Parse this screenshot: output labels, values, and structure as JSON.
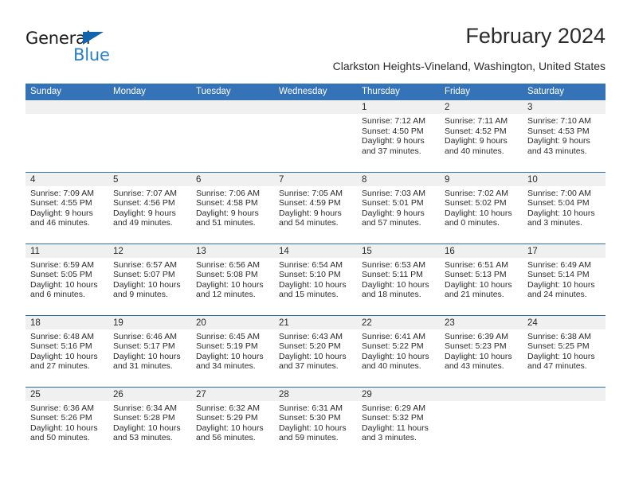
{
  "logo": {
    "word1": "General",
    "word2": "Blue",
    "triangle_color": "#1263ad",
    "blue_color": "#2a7fc9"
  },
  "header": {
    "title": "February 2024",
    "subtitle": "Clarkston Heights-Vineland, Washington, United States"
  },
  "theme": {
    "header_blue": "#3573b9",
    "separator_blue": "#2f6da8",
    "daynum_band": "#f0f0f0"
  },
  "calendar": {
    "weekdays": [
      "Sunday",
      "Monday",
      "Tuesday",
      "Wednesday",
      "Thursday",
      "Friday",
      "Saturday"
    ],
    "weeks": [
      [
        {
          "day": "",
          "lines": []
        },
        {
          "day": "",
          "lines": []
        },
        {
          "day": "",
          "lines": []
        },
        {
          "day": "",
          "lines": []
        },
        {
          "day": "1",
          "lines": [
            "Sunrise: 7:12 AM",
            "Sunset: 4:50 PM",
            "Daylight: 9 hours",
            "and 37 minutes."
          ]
        },
        {
          "day": "2",
          "lines": [
            "Sunrise: 7:11 AM",
            "Sunset: 4:52 PM",
            "Daylight: 9 hours",
            "and 40 minutes."
          ]
        },
        {
          "day": "3",
          "lines": [
            "Sunrise: 7:10 AM",
            "Sunset: 4:53 PM",
            "Daylight: 9 hours",
            "and 43 minutes."
          ]
        }
      ],
      [
        {
          "day": "4",
          "lines": [
            "Sunrise: 7:09 AM",
            "Sunset: 4:55 PM",
            "Daylight: 9 hours",
            "and 46 minutes."
          ]
        },
        {
          "day": "5",
          "lines": [
            "Sunrise: 7:07 AM",
            "Sunset: 4:56 PM",
            "Daylight: 9 hours",
            "and 49 minutes."
          ]
        },
        {
          "day": "6",
          "lines": [
            "Sunrise: 7:06 AM",
            "Sunset: 4:58 PM",
            "Daylight: 9 hours",
            "and 51 minutes."
          ]
        },
        {
          "day": "7",
          "lines": [
            "Sunrise: 7:05 AM",
            "Sunset: 4:59 PM",
            "Daylight: 9 hours",
            "and 54 minutes."
          ]
        },
        {
          "day": "8",
          "lines": [
            "Sunrise: 7:03 AM",
            "Sunset: 5:01 PM",
            "Daylight: 9 hours",
            "and 57 minutes."
          ]
        },
        {
          "day": "9",
          "lines": [
            "Sunrise: 7:02 AM",
            "Sunset: 5:02 PM",
            "Daylight: 10 hours",
            "and 0 minutes."
          ]
        },
        {
          "day": "10",
          "lines": [
            "Sunrise: 7:00 AM",
            "Sunset: 5:04 PM",
            "Daylight: 10 hours",
            "and 3 minutes."
          ]
        }
      ],
      [
        {
          "day": "11",
          "lines": [
            "Sunrise: 6:59 AM",
            "Sunset: 5:05 PM",
            "Daylight: 10 hours",
            "and 6 minutes."
          ]
        },
        {
          "day": "12",
          "lines": [
            "Sunrise: 6:57 AM",
            "Sunset: 5:07 PM",
            "Daylight: 10 hours",
            "and 9 minutes."
          ]
        },
        {
          "day": "13",
          "lines": [
            "Sunrise: 6:56 AM",
            "Sunset: 5:08 PM",
            "Daylight: 10 hours",
            "and 12 minutes."
          ]
        },
        {
          "day": "14",
          "lines": [
            "Sunrise: 6:54 AM",
            "Sunset: 5:10 PM",
            "Daylight: 10 hours",
            "and 15 minutes."
          ]
        },
        {
          "day": "15",
          "lines": [
            "Sunrise: 6:53 AM",
            "Sunset: 5:11 PM",
            "Daylight: 10 hours",
            "and 18 minutes."
          ]
        },
        {
          "day": "16",
          "lines": [
            "Sunrise: 6:51 AM",
            "Sunset: 5:13 PM",
            "Daylight: 10 hours",
            "and 21 minutes."
          ]
        },
        {
          "day": "17",
          "lines": [
            "Sunrise: 6:49 AM",
            "Sunset: 5:14 PM",
            "Daylight: 10 hours",
            "and 24 minutes."
          ]
        }
      ],
      [
        {
          "day": "18",
          "lines": [
            "Sunrise: 6:48 AM",
            "Sunset: 5:16 PM",
            "Daylight: 10 hours",
            "and 27 minutes."
          ]
        },
        {
          "day": "19",
          "lines": [
            "Sunrise: 6:46 AM",
            "Sunset: 5:17 PM",
            "Daylight: 10 hours",
            "and 31 minutes."
          ]
        },
        {
          "day": "20",
          "lines": [
            "Sunrise: 6:45 AM",
            "Sunset: 5:19 PM",
            "Daylight: 10 hours",
            "and 34 minutes."
          ]
        },
        {
          "day": "21",
          "lines": [
            "Sunrise: 6:43 AM",
            "Sunset: 5:20 PM",
            "Daylight: 10 hours",
            "and 37 minutes."
          ]
        },
        {
          "day": "22",
          "lines": [
            "Sunrise: 6:41 AM",
            "Sunset: 5:22 PM",
            "Daylight: 10 hours",
            "and 40 minutes."
          ]
        },
        {
          "day": "23",
          "lines": [
            "Sunrise: 6:39 AM",
            "Sunset: 5:23 PM",
            "Daylight: 10 hours",
            "and 43 minutes."
          ]
        },
        {
          "day": "24",
          "lines": [
            "Sunrise: 6:38 AM",
            "Sunset: 5:25 PM",
            "Daylight: 10 hours",
            "and 47 minutes."
          ]
        }
      ],
      [
        {
          "day": "25",
          "lines": [
            "Sunrise: 6:36 AM",
            "Sunset: 5:26 PM",
            "Daylight: 10 hours",
            "and 50 minutes."
          ]
        },
        {
          "day": "26",
          "lines": [
            "Sunrise: 6:34 AM",
            "Sunset: 5:28 PM",
            "Daylight: 10 hours",
            "and 53 minutes."
          ]
        },
        {
          "day": "27",
          "lines": [
            "Sunrise: 6:32 AM",
            "Sunset: 5:29 PM",
            "Daylight: 10 hours",
            "and 56 minutes."
          ]
        },
        {
          "day": "28",
          "lines": [
            "Sunrise: 6:31 AM",
            "Sunset: 5:30 PM",
            "Daylight: 10 hours",
            "and 59 minutes."
          ]
        },
        {
          "day": "29",
          "lines": [
            "Sunrise: 6:29 AM",
            "Sunset: 5:32 PM",
            "Daylight: 11 hours",
            "and 3 minutes."
          ]
        },
        {
          "day": "",
          "lines": []
        },
        {
          "day": "",
          "lines": []
        }
      ]
    ]
  }
}
